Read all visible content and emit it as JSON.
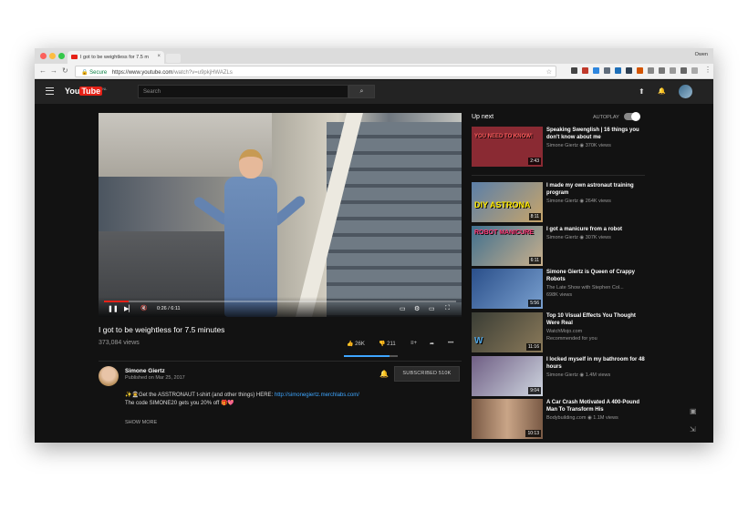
{
  "browser": {
    "tab_title": "I got to be weightless for 7.5 m",
    "tab_close": "×",
    "profile": "Owen",
    "secure_label": "Secure",
    "url_host": "https://www.youtube.com",
    "url_path": "/watch?v=u9pkjHWAZLs",
    "nav_back": "←",
    "nav_forward": "→",
    "nav_reload": "↻",
    "star": "☆"
  },
  "header": {
    "logo_you": "You",
    "logo_tube": "Tube",
    "logo_region": "NL",
    "search_placeholder": "Search",
    "search_button": "⌕",
    "upload_icon": "⬆",
    "bell_icon": "🔔"
  },
  "player": {
    "time": "0:26 / 6:11",
    "progress": 0.07,
    "play": "❚❚",
    "next": "▶▏",
    "mute": "🔇",
    "cc": "▭",
    "settings": "⚙",
    "theater": "▭",
    "fullscreen": "⛶"
  },
  "video": {
    "title": "I got to be weightless for 7.5 minutes",
    "views": "373,084 views",
    "likes": "26K",
    "dislikes": "211",
    "like_ratio": 0.85
  },
  "channel": {
    "name": "Simone Giertz",
    "published": "Published on Mar 25, 2017",
    "subscribe": "SUBSCRIBED 510K",
    "desc_line1_pre": "✨👨‍🚀Get the ASSTRONAUT t-shirt (and other things) HERE: ",
    "desc_link": "http://simonegiertz.merchlabs.com/",
    "desc_line2": "The code SIMONE20 gets you 20% off 🎁💖",
    "show_more": "SHOW MORE"
  },
  "sidebar": {
    "up_next": "Up next",
    "autoplay": "AUTOPLAY",
    "items": [
      {
        "title": "Speaking Swenglish | 16 things you don't know about me",
        "channel": "Simone Giertz",
        "meta": "370K views",
        "duration": "2:43",
        "thumb_text": "YOU NEED TO KNOW!",
        "color": "#8a2a33"
      },
      {
        "title": "I made my own astronaut training program",
        "channel": "Simone Giertz",
        "meta": "264K views",
        "duration": "8:11",
        "thumb_text": "DIY ASTRONA",
        "color": "#5b7fa8"
      },
      {
        "title": "I got a manicure from a robot",
        "channel": "Simone Giertz",
        "meta": "307K views",
        "duration": "6:11",
        "thumb_text": "ROBOT MANICURE",
        "color": "#3f6f8f"
      },
      {
        "title": "Simone Giertz is Queen of Crappy Robots",
        "channel": "The Late Show with Stephen Col...",
        "meta": "698K views",
        "duration": "5:56",
        "thumb_text": "",
        "color": "#2a4f8a"
      },
      {
        "title": "Top 10 Visual Effects You Thought Were Real",
        "channel": "WatchMojo.com",
        "meta": "Recommended for you",
        "duration": "11:16",
        "thumb_text": "W",
        "color": "#3a3d35"
      },
      {
        "title": "I locked myself in my bathroom for 48 hours",
        "channel": "Simone Giertz",
        "meta": "1.4M views",
        "duration": "9:04",
        "thumb_text": "",
        "color": "#6f5e84"
      },
      {
        "title": "A Car Crash Motivated A 400-Pound Man To Transform His",
        "channel": "Bodybuilding.com",
        "meta": "1.1M views",
        "duration": "10:13",
        "thumb_text": "",
        "color": "#7a5a45"
      }
    ]
  }
}
